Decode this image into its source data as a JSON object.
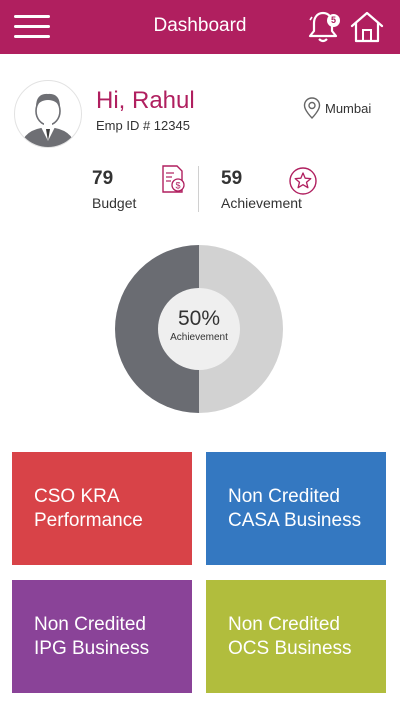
{
  "header": {
    "title": "Dashboard",
    "notification_count": "5",
    "color": "#b01f5f"
  },
  "profile": {
    "greeting": "Hi, Rahul",
    "emp_id": "Emp ID # 12345",
    "location": "Mumbai"
  },
  "stats": {
    "budget": {
      "value": "79",
      "label": "Budget"
    },
    "achievement": {
      "value": "59",
      "label": "Achievement"
    }
  },
  "donut": {
    "percent_label": "50%",
    "caption": "Achievement",
    "achieved_fraction": 0.5,
    "colors": {
      "achieved": "#6a6c72",
      "remaining": "#d2d2d2",
      "center": "#efefef"
    }
  },
  "tiles": [
    {
      "line1": "CSO KRA",
      "line2": "Performance",
      "color": "#d84348"
    },
    {
      "line1": "Non Credited",
      "line2": "CASA Business",
      "color": "#3478c1"
    },
    {
      "line1": "Non Credited",
      "line2": "IPG Business",
      "color": "#8a4398"
    },
    {
      "line1": "Non Credited",
      "line2": "OCS Business",
      "color": "#b1bd3d"
    }
  ]
}
